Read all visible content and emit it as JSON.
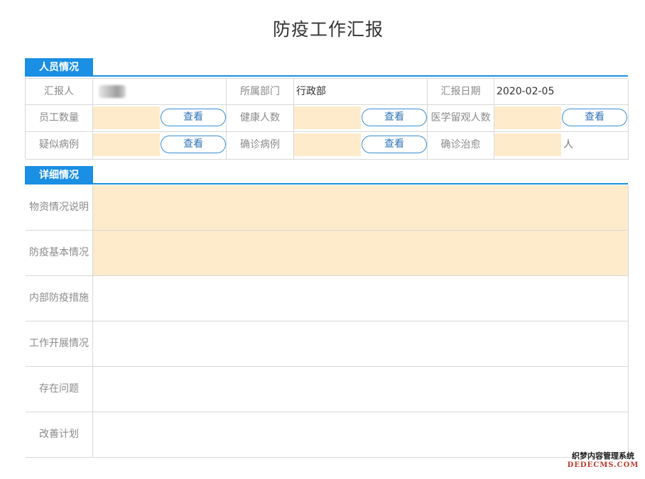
{
  "title": "防疫工作汇报",
  "sections": {
    "personnel": "人员情况",
    "details": "详细情况"
  },
  "info": {
    "reporter_label": "汇报人",
    "department_label": "所属部门",
    "department_value": "行政部",
    "date_label": "汇报日期",
    "date_value": "2020-02-05",
    "staff_label": "员工数量",
    "healthy_label": "健康人数",
    "observation_label": "医学留观人数",
    "suspected_label": "疑似病例",
    "confirmed_label": "确诊病例",
    "cured_label": "确诊治愈",
    "cured_unit": "人",
    "view_button": "查看"
  },
  "detail_rows": [
    {
      "label": "物资情况说明",
      "highlight": true
    },
    {
      "label": "防疫基本情况",
      "highlight": true
    },
    {
      "label": "内部防疫措施",
      "highlight": false
    },
    {
      "label": "工作开展情况",
      "highlight": false
    },
    {
      "label": "存在问题",
      "highlight": false
    },
    {
      "label": "改善计划",
      "highlight": false
    }
  ],
  "colors": {
    "accent": "#1a8fe3",
    "input_fill": "#fdebcb",
    "border": "#d8d8d8"
  },
  "watermark": {
    "line1": "织梦内容管理系统",
    "line2": "DEDECMS.COM"
  }
}
